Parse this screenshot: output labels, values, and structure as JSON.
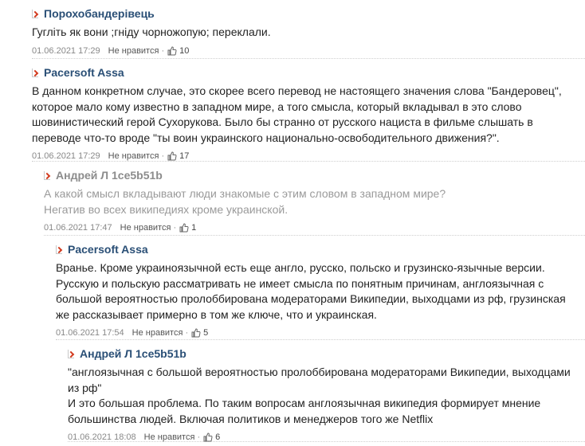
{
  "comments": [
    {
      "author": "Порохобандерівець",
      "text": "Гугліть як вони ;гніду чорножопую; переклали.",
      "date": "01.06.2021 17:29",
      "like_label": "Не нравится",
      "separator": "·",
      "likes": "10"
    },
    {
      "author": "Pacersoft Assa",
      "text": "В данном конкретном случае, это скорее всего перевод не настоящего значения слова \"Бандеровец\",\nкоторое мало кому известно в западном мире, а того смысла, который вкладывал в это слово\nшовинистический герой Сухорукова. Было бы странно от русского нациста в фильме слышать в\nпереводе что-то вроде \"ты воин украинского национально-освободительного движения?\".",
      "date": "01.06.2021 17:29",
      "like_label": "Не нравится",
      "separator": "·",
      "likes": "17"
    },
    {
      "author": "Андрей Л 1ce5b51b",
      "text": "А какой смысл вкладывают люди знакомые с этим словом в западном мире?\nНегатив во всех википедиях кроме украинской.",
      "date": "01.06.2021 17:47",
      "like_label": "Не нравится",
      "separator": "·",
      "likes": "1"
    },
    {
      "author": "Pacersoft Assa",
      "text": "Вранье. Кроме украиноязычной есть еще англо, русско, польско и грузинско-язычные версии.\nРусскую и польскую рассматривать не имеет смысла по понятным причинам, англоязычная с\nбольшой вероятностью пролоббирована модераторами Википедии, выходцами из рф, грузинская\nже рассказывает примерно в том же ключе, что и украинская.",
      "date": "01.06.2021 17:54",
      "like_label": "Не нравится",
      "separator": "·",
      "likes": "5"
    },
    {
      "author": "Андрей Л 1ce5b51b",
      "text": "\"англоязычная с большой вероятностью пролоббирована модераторами Википедии, выходцами\nиз рф\"\nИ это большая проблема. По таким вопросам англоязычная википедия формирует мнение\nбольшинства людей. Включая политиков и менеджеров того же Netflix",
      "date": "01.06.2021 18:08",
      "like_label": "Не нравится",
      "separator": "·",
      "likes": "6"
    }
  ]
}
